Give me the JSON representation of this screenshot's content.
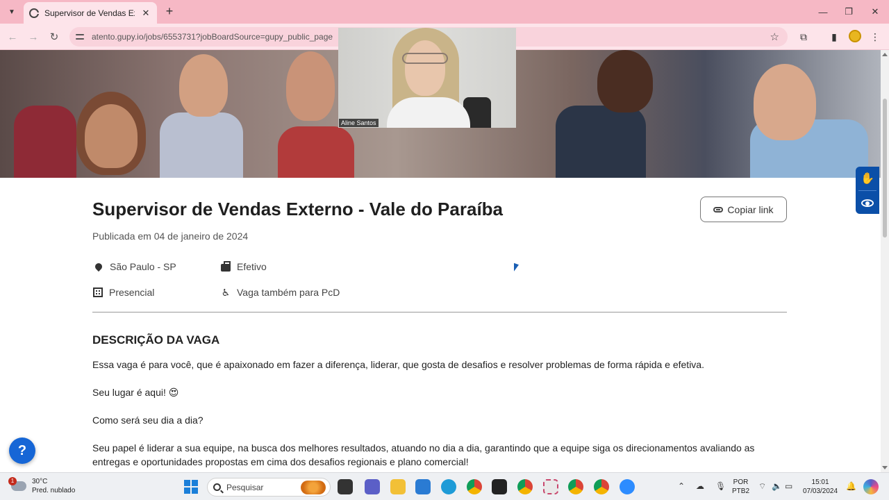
{
  "browser": {
    "tab_title": "Supervisor de Vendas Externo",
    "tab_close": "✕",
    "new_tab": "+",
    "url": "atento.gupy.io/jobs/6553731?jobBoardSource=gupy_public_page",
    "window_controls": {
      "minimize": "—",
      "maximize": "❐",
      "close": "✕"
    }
  },
  "video_call": {
    "participant_name": "Aline Santos"
  },
  "job": {
    "title": "Supervisor de Vendas Externo - Vale do Paraíba",
    "copy_link_label": "Copiar link",
    "published": "Publicada em 04 de janeiro de 2024",
    "location": "São Paulo - SP",
    "contract_type": "Efetivo",
    "workplace": "Presencial",
    "pcd": "Vaga também para PcD",
    "section_title": "DESCRIÇÃO DA VAGA",
    "paragraphs": {
      "p1": "Essa vaga é para você, que é apaixonado em fazer a diferença, liderar, que gosta de desafios e resolver problemas de forma rápida e efetiva.",
      "p2": "Seu lugar é aqui! 😍",
      "p3": "Como será seu dia a dia?",
      "p4": "Seu papel é liderar a sua equipe, na busca dos melhores resultados, atuando no dia a dia, garantindo que a equipe siga os direcionamentos avaliando as entregas e oportunidades propostas em cima dos desafios regionais e plano comercial!"
    }
  },
  "help_button": "?",
  "taskbar": {
    "weather_temp": "30°C",
    "weather_desc": "Pred. nublado",
    "weather_badge": "1",
    "search_placeholder": "Pesquisar",
    "language": "POR",
    "layout": "PTB2",
    "time": "15:01",
    "date": "07/03/2024"
  },
  "colors": {
    "tab_strip": "#f6b8c5",
    "toolbar": "#fde4ea",
    "accessibility_blue": "#0b4fa8",
    "help_blue": "#1666d6"
  }
}
